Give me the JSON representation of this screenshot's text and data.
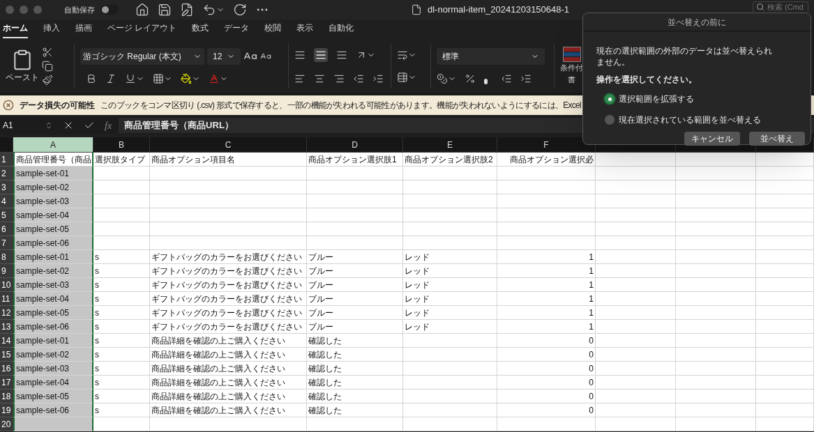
{
  "window": {
    "title": "dl-normal-item_20241203150648-1",
    "autosave_label": "自動保存",
    "autosave_on": false
  },
  "search": {
    "placeholder": "検索 (Cmd"
  },
  "ribbon_tabs": [
    {
      "label": "ホーム",
      "selected": true
    },
    {
      "label": "挿入",
      "selected": false
    },
    {
      "label": "描画",
      "selected": false
    },
    {
      "label": "ページ レイアウト",
      "selected": false
    },
    {
      "label": "数式",
      "selected": false
    },
    {
      "label": "データ",
      "selected": false
    },
    {
      "label": "校閲",
      "selected": false
    },
    {
      "label": "表示",
      "selected": false
    },
    {
      "label": "自動化",
      "selected": false
    }
  ],
  "ribbon": {
    "paste_label": "ペースト",
    "font_name": "游ゴシック Regular (本文)",
    "font_size": "12",
    "number_format": "標準",
    "conditional_format_label": [
      "条件付",
      "書"
    ]
  },
  "warning": {
    "title": "データ損失の可能性",
    "message": "このブックをコンマ区切り (.csv) 形式で保存すると、一部の機能が失われる可能性があります。機能が失われないようにするには、Excel"
  },
  "formula_bar": {
    "cell_ref": "A1",
    "function_label": "fx",
    "formula": "商品管理番号（商品URL）"
  },
  "sheet": {
    "columns": [
      {
        "label": "A",
        "selected": true
      },
      {
        "label": "B",
        "selected": false
      },
      {
        "label": "C",
        "selected": false
      },
      {
        "label": "D",
        "selected": false
      },
      {
        "label": "E",
        "selected": false
      },
      {
        "label": "F",
        "selected": false
      }
    ],
    "rows": [
      {
        "number": "1",
        "cells": [
          "商品管理番号（商品",
          "選択肢タイプ",
          "商品オプション項目名",
          "商品オプション選択肢1",
          "商品オプション選択肢2",
          "商品オプション選択必"
        ]
      },
      {
        "number": "2",
        "cells": [
          "sample-set-01",
          "",
          "",
          "",
          "",
          ""
        ]
      },
      {
        "number": "3",
        "cells": [
          "sample-set-02",
          "",
          "",
          "",
          "",
          ""
        ]
      },
      {
        "number": "4",
        "cells": [
          "sample-set-03",
          "",
          "",
          "",
          "",
          ""
        ]
      },
      {
        "number": "5",
        "cells": [
          "sample-set-04",
          "",
          "",
          "",
          "",
          ""
        ]
      },
      {
        "number": "6",
        "cells": [
          "sample-set-05",
          "",
          "",
          "",
          "",
          ""
        ]
      },
      {
        "number": "7",
        "cells": [
          "sample-set-06",
          "",
          "",
          "",
          "",
          ""
        ]
      },
      {
        "number": "8",
        "cells": [
          "sample-set-01",
          "s",
          "ギフトバッグのカラーをお選びください",
          "ブルー",
          "レッド",
          "1"
        ]
      },
      {
        "number": "9",
        "cells": [
          "sample-set-02",
          "s",
          "ギフトバッグのカラーをお選びください",
          "ブルー",
          "レッド",
          "1"
        ]
      },
      {
        "number": "10",
        "cells": [
          "sample-set-03",
          "s",
          "ギフトバッグのカラーをお選びください",
          "ブルー",
          "レッド",
          "1"
        ]
      },
      {
        "number": "11",
        "cells": [
          "sample-set-04",
          "s",
          "ギフトバッグのカラーをお選びください",
          "ブルー",
          "レッド",
          "1"
        ]
      },
      {
        "number": "12",
        "cells": [
          "sample-set-05",
          "s",
          "ギフトバッグのカラーをお選びください",
          "ブルー",
          "レッド",
          "1"
        ]
      },
      {
        "number": "13",
        "cells": [
          "sample-set-06",
          "s",
          "ギフトバッグのカラーをお選びください",
          "ブルー",
          "レッド",
          "1"
        ]
      },
      {
        "number": "14",
        "cells": [
          "sample-set-01",
          "s",
          "商品詳細を確認の上ご購入ください",
          "確認した",
          "",
          "0"
        ]
      },
      {
        "number": "15",
        "cells": [
          "sample-set-02",
          "s",
          "商品詳細を確認の上ご購入ください",
          "確認した",
          "",
          "0"
        ]
      },
      {
        "number": "16",
        "cells": [
          "sample-set-03",
          "s",
          "商品詳細を確認の上ご購入ください",
          "確認した",
          "",
          "0"
        ]
      },
      {
        "number": "17",
        "cells": [
          "sample-set-04",
          "s",
          "商品詳細を確認の上ご購入ください",
          "確認した",
          "",
          "0"
        ]
      },
      {
        "number": "18",
        "cells": [
          "sample-set-05",
          "s",
          "商品詳細を確認の上ご購入ください",
          "確認した",
          "",
          "0"
        ]
      },
      {
        "number": "19",
        "cells": [
          "sample-set-06",
          "s",
          "商品詳細を確認の上ご購入ください",
          "確認した",
          "",
          "0"
        ]
      },
      {
        "number": "20",
        "cells": [
          "",
          "",
          "",
          "",
          "",
          ""
        ]
      }
    ]
  },
  "dialog": {
    "title": "並べ替えの前に",
    "message": "現在の選択範囲の外部のデータは並べ替えられません。",
    "prompt": "操作を選択してください。",
    "options": [
      {
        "label": "選択範囲を拡張する",
        "selected": true
      },
      {
        "label": "現在選択されている範囲を並べ替える",
        "selected": false
      }
    ],
    "buttons": [
      "キャンセル",
      "並べ替え"
    ]
  }
}
